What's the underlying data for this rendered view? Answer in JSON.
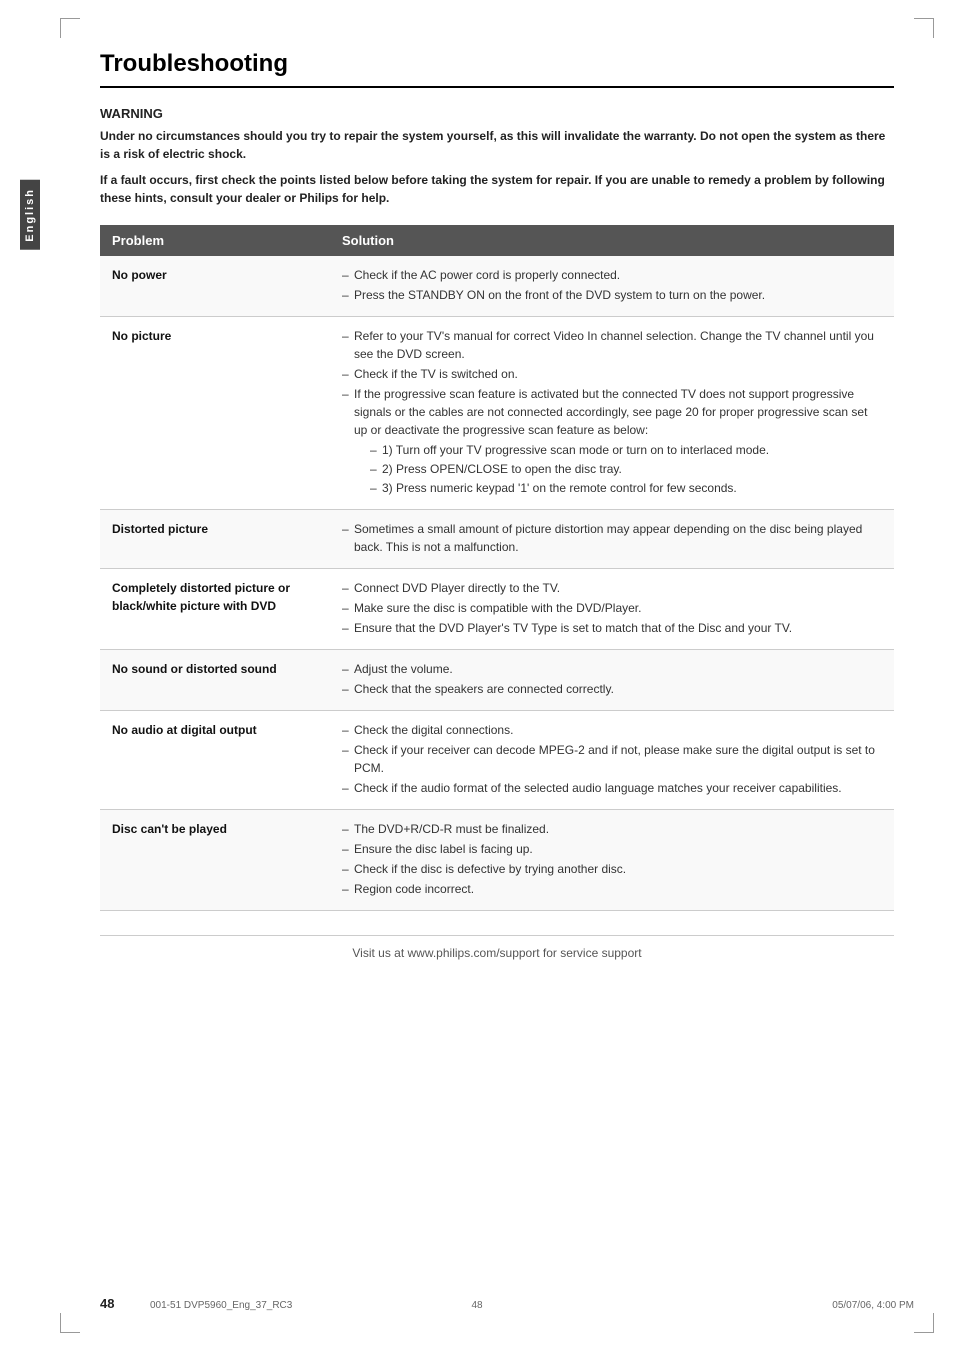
{
  "page": {
    "title": "Troubleshooting",
    "side_label": "English",
    "page_number": "48",
    "print_info_left": "001-51 DVP5960_Eng_37_RC3",
    "print_info_center": "48",
    "print_info_right": "05/07/06, 4:00 PM"
  },
  "warning": {
    "title": "WARNING",
    "line1": "Under no circumstances should you try to repair the system yourself, as this will invalidate the warranty.  Do not open the system as there is a risk of electric shock.",
    "line2": "If a fault occurs, first check the points listed below before taking the system for repair. If you are unable to remedy a problem by following these hints, consult your dealer or Philips for help."
  },
  "table": {
    "col_problem": "Problem",
    "col_solution": "Solution",
    "rows": [
      {
        "problem": "No power",
        "solutions": [
          "Check if the AC power cord is properly connected.",
          "Press the STANDBY ON on the front of the DVD system to turn on the power."
        ]
      },
      {
        "problem": "No picture",
        "solutions": [
          "Refer to your TV's manual for correct Video In channel selection.  Change the TV channel until you see the DVD screen.",
          "Check if the TV is switched on.",
          "If the progressive scan feature is activated but the connected TV does not support progressive signals or the cables are not connected accordingly, see page 20 for proper progressive scan set up or deactivate the progressive scan feature as below:",
          "1) Turn off your TV progressive scan mode or turn on to interlaced mode.",
          "2) Press OPEN/CLOSE to open the disc tray.",
          "3) Press numeric keypad '1' on the remote control for few seconds."
        ],
        "has_sub": true
      },
      {
        "problem": "Distorted picture",
        "solutions": [
          "Sometimes a small amount of picture distortion may appear depending on the disc being played back. This is not a malfunction."
        ]
      },
      {
        "problem": "Completely distorted picture or black/white picture with DVD",
        "solutions": [
          "Connect DVD Player directly to the TV.",
          "Make sure the disc is compatible with the DVD/Player.",
          "Ensure that the DVD Player's TV Type is set to match that of the Disc and your TV."
        ]
      },
      {
        "problem": "No sound or distorted sound",
        "solutions": [
          "Adjust the volume.",
          "Check that the speakers are connected correctly."
        ]
      },
      {
        "problem": "No audio at digital output",
        "solutions": [
          "Check the digital connections.",
          "Check if your receiver can decode MPEG-2 and if not, please make sure the digital output is set to PCM.",
          "Check if the audio format of the selected audio language matches your receiver capabilities."
        ]
      },
      {
        "problem": "Disc can't be played",
        "solutions": [
          "The DVD+R/CD-R must be finalized.",
          "Ensure the disc label is facing up.",
          "Check if the disc is defective by trying another disc.",
          "Region code incorrect."
        ]
      }
    ]
  },
  "footer": {
    "text": "Visit us at www.philips.com/support for service support"
  }
}
